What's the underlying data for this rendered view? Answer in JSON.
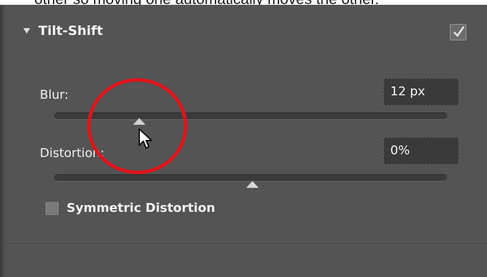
{
  "caption": {
    "text": "other so moving one automatically moves the other."
  },
  "panel": {
    "title": "Tilt-Shift",
    "enabled": true
  },
  "blur": {
    "label": "Blur:",
    "value": "12 px",
    "slider_fraction": 0.217
  },
  "distortion": {
    "label": "Distortion:",
    "value": "0%",
    "slider_fraction": 0.505
  },
  "symmetric": {
    "label": "Symmetric Distortion",
    "checked": false
  },
  "icons": {
    "disclosure": "triangle-down-icon",
    "enable": "checkbox-checked-icon",
    "cursor": "arrow-cursor-icon"
  },
  "colors": {
    "panel_bg": "#545454",
    "callout": "#e0141b",
    "field_bg": "#3a3a3a"
  }
}
